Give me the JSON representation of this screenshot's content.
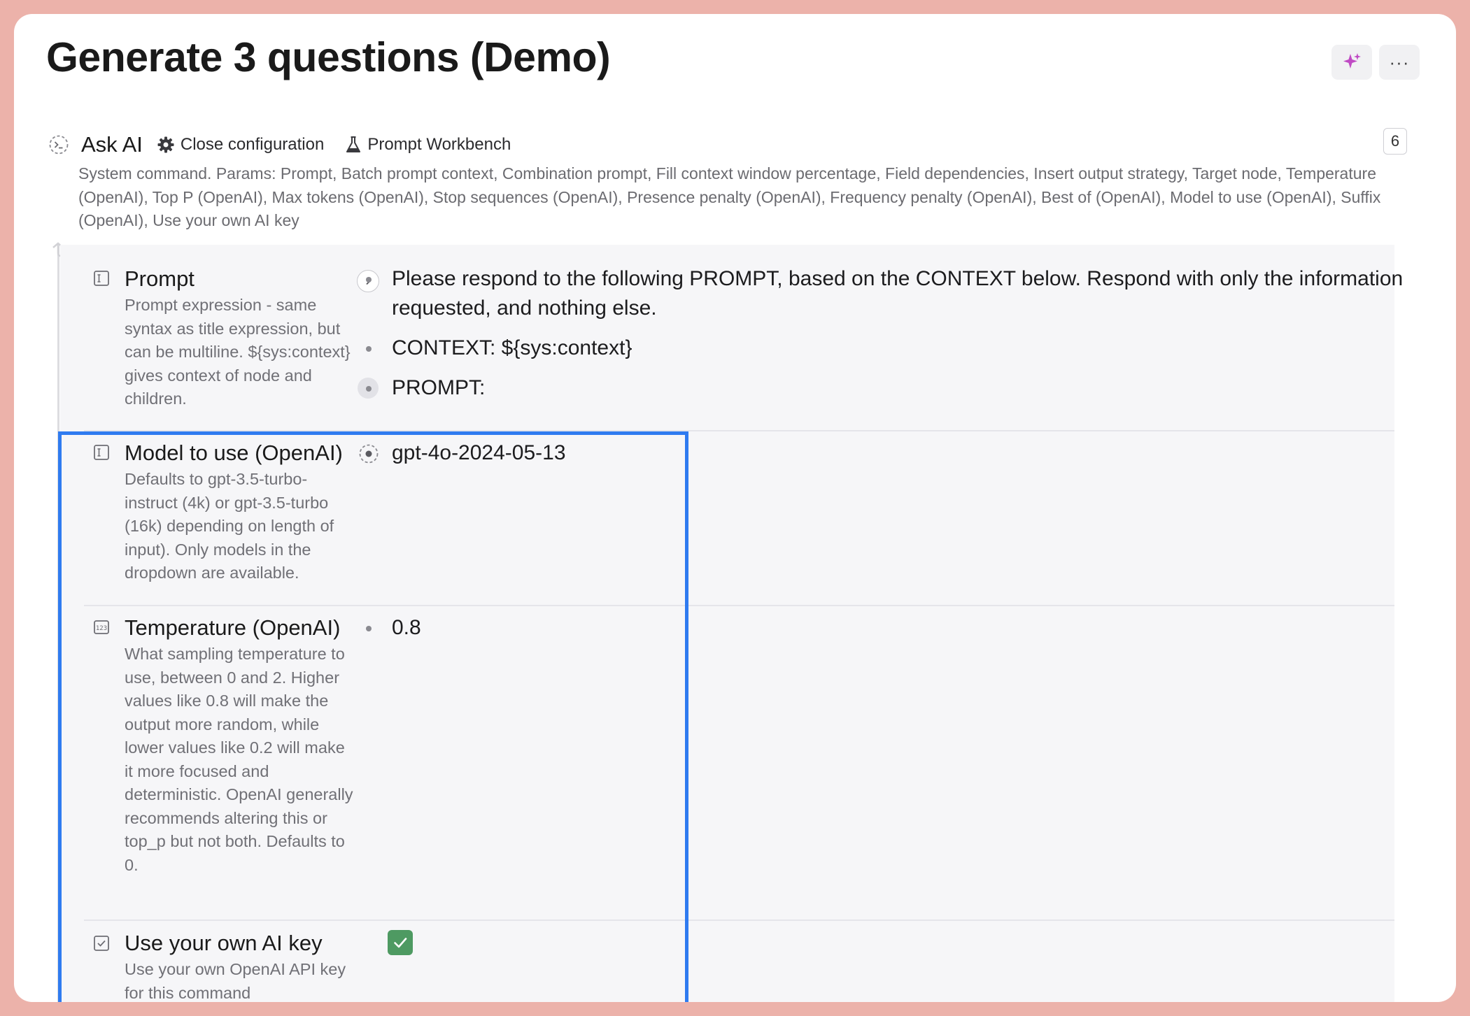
{
  "page": {
    "title": "Generate 3 questions (Demo)",
    "top_buttons": {
      "ai_icon": "sparkle-icon",
      "more_label": "···"
    }
  },
  "command": {
    "icon": "command-prompt-icon",
    "name": "Ask AI",
    "close_config_label": "Close configuration",
    "workbench_label": "Prompt Workbench",
    "badge_count": "6",
    "description": "System command. Params: Prompt, Batch prompt context, Combination prompt, Fill context window percentage, Field dependencies, Insert output strategy, Target node, Temperature (OpenAI), Top P (OpenAI), Max tokens (OpenAI), Stop sequences (OpenAI), Presence penalty (OpenAI), Frequency penalty (OpenAI), Best of (OpenAI), Model to use (OpenAI), Suffix (OpenAI), Use your own AI key"
  },
  "fields": {
    "prompt": {
      "icon": "text-field-icon",
      "label": "Prompt",
      "description": "Prompt expression - same syntax as title expression, but can be multiline. ${sys:context} gives context of node and children.",
      "values": [
        "Please respond to the following PROMPT, based on the CONTEXT below. Respond with only the information requested, and nothing else.",
        "CONTEXT: ${sys:context}",
        "PROMPT:"
      ]
    },
    "model": {
      "icon": "text-field-icon",
      "label": "Model to use (OpenAI)",
      "description": "Defaults to gpt-3.5-turbo-instruct (4k) or gpt-3.5-turbo (16k) depending on length of input). Only models in the dropdown are available.",
      "value": "gpt-4o-2024-05-13"
    },
    "temperature": {
      "icon": "number-field-icon",
      "label": "Temperature (OpenAI)",
      "description": "What sampling temperature to use, between 0 and 2. Higher values like 0.8 will make the output more random, while lower values like 0.2 will make it more focused and deterministic. OpenAI generally recommends altering this or top_p but not both. Defaults to 0.",
      "value": "0.8"
    },
    "own_key": {
      "icon": "checkbox-field-icon",
      "label": "Use your own AI key",
      "description": "Use your own OpenAI API key for this command",
      "checked": true
    }
  },
  "colors": {
    "background": "#ecb2aa",
    "highlight": "#2f7bf0",
    "checkbox": "#4e9a62",
    "sparkle": "#c04bc4"
  }
}
